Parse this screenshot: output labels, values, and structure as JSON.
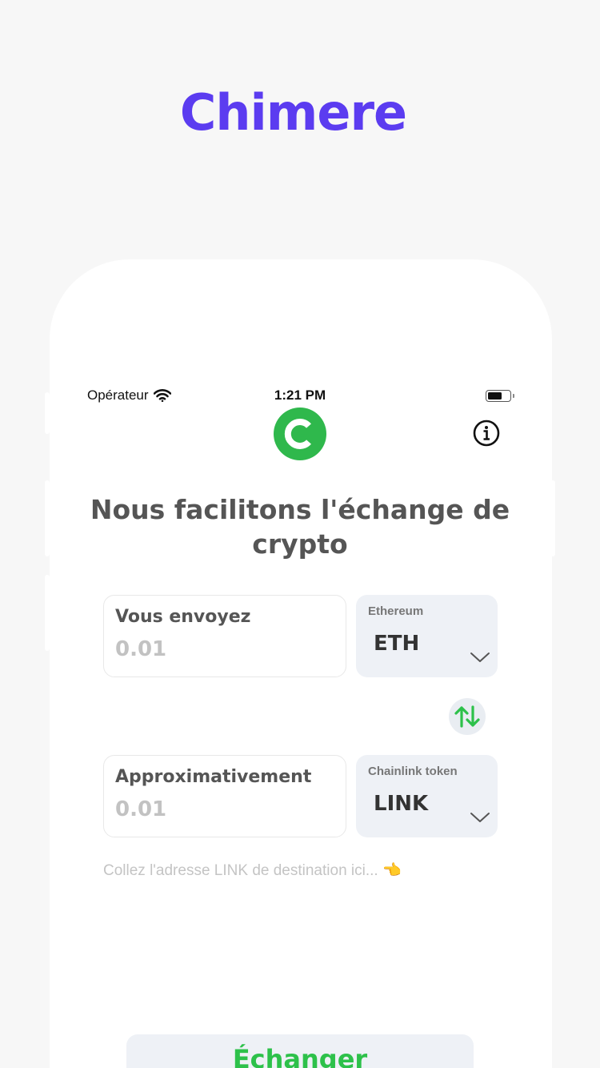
{
  "promo": {
    "title": "Chimere"
  },
  "status_bar": {
    "carrier": "Opérateur",
    "time": "1:21 PM"
  },
  "header": {
    "logo_icon": "chimere-logo-icon",
    "info_icon": "info-icon"
  },
  "headline": "Nous facilitons l'échange de crypto",
  "send": {
    "label": "Vous envoyez",
    "value": "0.01",
    "coin_name": "Ethereum",
    "coin_symbol": "ETH"
  },
  "receive": {
    "label": "Approximativement",
    "value": "0.01",
    "coin_name": "Chainlink token",
    "coin_symbol": "LINK"
  },
  "address": {
    "placeholder": "Collez l'adresse LINK de destination ici... 👈"
  },
  "exchange_button": {
    "label": "Échanger"
  },
  "colors": {
    "accent": "#5b3cf0",
    "green": "#2dc14a",
    "logo_green": "#2fb84c"
  }
}
